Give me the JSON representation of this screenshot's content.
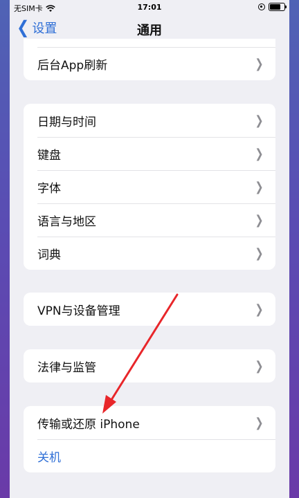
{
  "status": {
    "carrier": "无SIM卡",
    "time": "17:01",
    "battery_level": 0.75
  },
  "nav": {
    "back_label": "设置",
    "title": "通用"
  },
  "groups": [
    {
      "rows": [
        {
          "label": "后台App刷新"
        }
      ]
    },
    {
      "rows": [
        {
          "label": "日期与时间"
        },
        {
          "label": "键盘"
        },
        {
          "label": "字体"
        },
        {
          "label": "语言与地区"
        },
        {
          "label": "词典"
        }
      ]
    },
    {
      "rows": [
        {
          "label": "VPN与设备管理"
        }
      ]
    },
    {
      "rows": [
        {
          "label": "法律与监管"
        }
      ]
    },
    {
      "rows": [
        {
          "label": "传输或还原 iPhone"
        },
        {
          "label": "关机"
        }
      ]
    }
  ],
  "colors": {
    "accent": "#2f6fd6",
    "background": "#efeff4",
    "annotation_arrow": "#e8262a"
  }
}
